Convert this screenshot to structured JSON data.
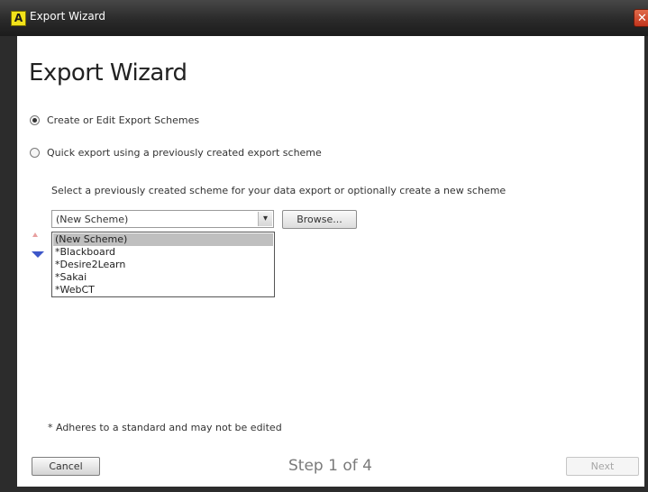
{
  "window": {
    "title": "Export Wizard",
    "close_glyph": "✕",
    "app_icon_letter": "A"
  },
  "page": {
    "heading": "Export Wizard"
  },
  "options": {
    "create_edit": {
      "label": "Create or Edit Export Schemes",
      "checked": true
    },
    "quick_export": {
      "label": "Quick export using a previously created export scheme",
      "checked": false
    }
  },
  "scheme": {
    "helper_text": "Select a previously created scheme for your data export or optionally create a new scheme",
    "selected": "(New Scheme)",
    "dropdown_arrow": "▾",
    "options": [
      "(New Scheme)",
      "*Blackboard",
      "*Desire2Learn",
      "*Sakai",
      "*WebCT"
    ],
    "browse_label": "Browse..."
  },
  "footer": {
    "note": "* Adheres to a standard and may not be edited",
    "cancel_label": "Cancel",
    "step_label": "Step 1 of 4",
    "next_label": "Next"
  },
  "colors": {
    "titlebar": "#2a2a2a",
    "app_icon": "#f2e21a",
    "close_button": "#c2341c",
    "dropdown_highlight": "#bfbfbf",
    "marker_blue": "#3d57c9"
  }
}
